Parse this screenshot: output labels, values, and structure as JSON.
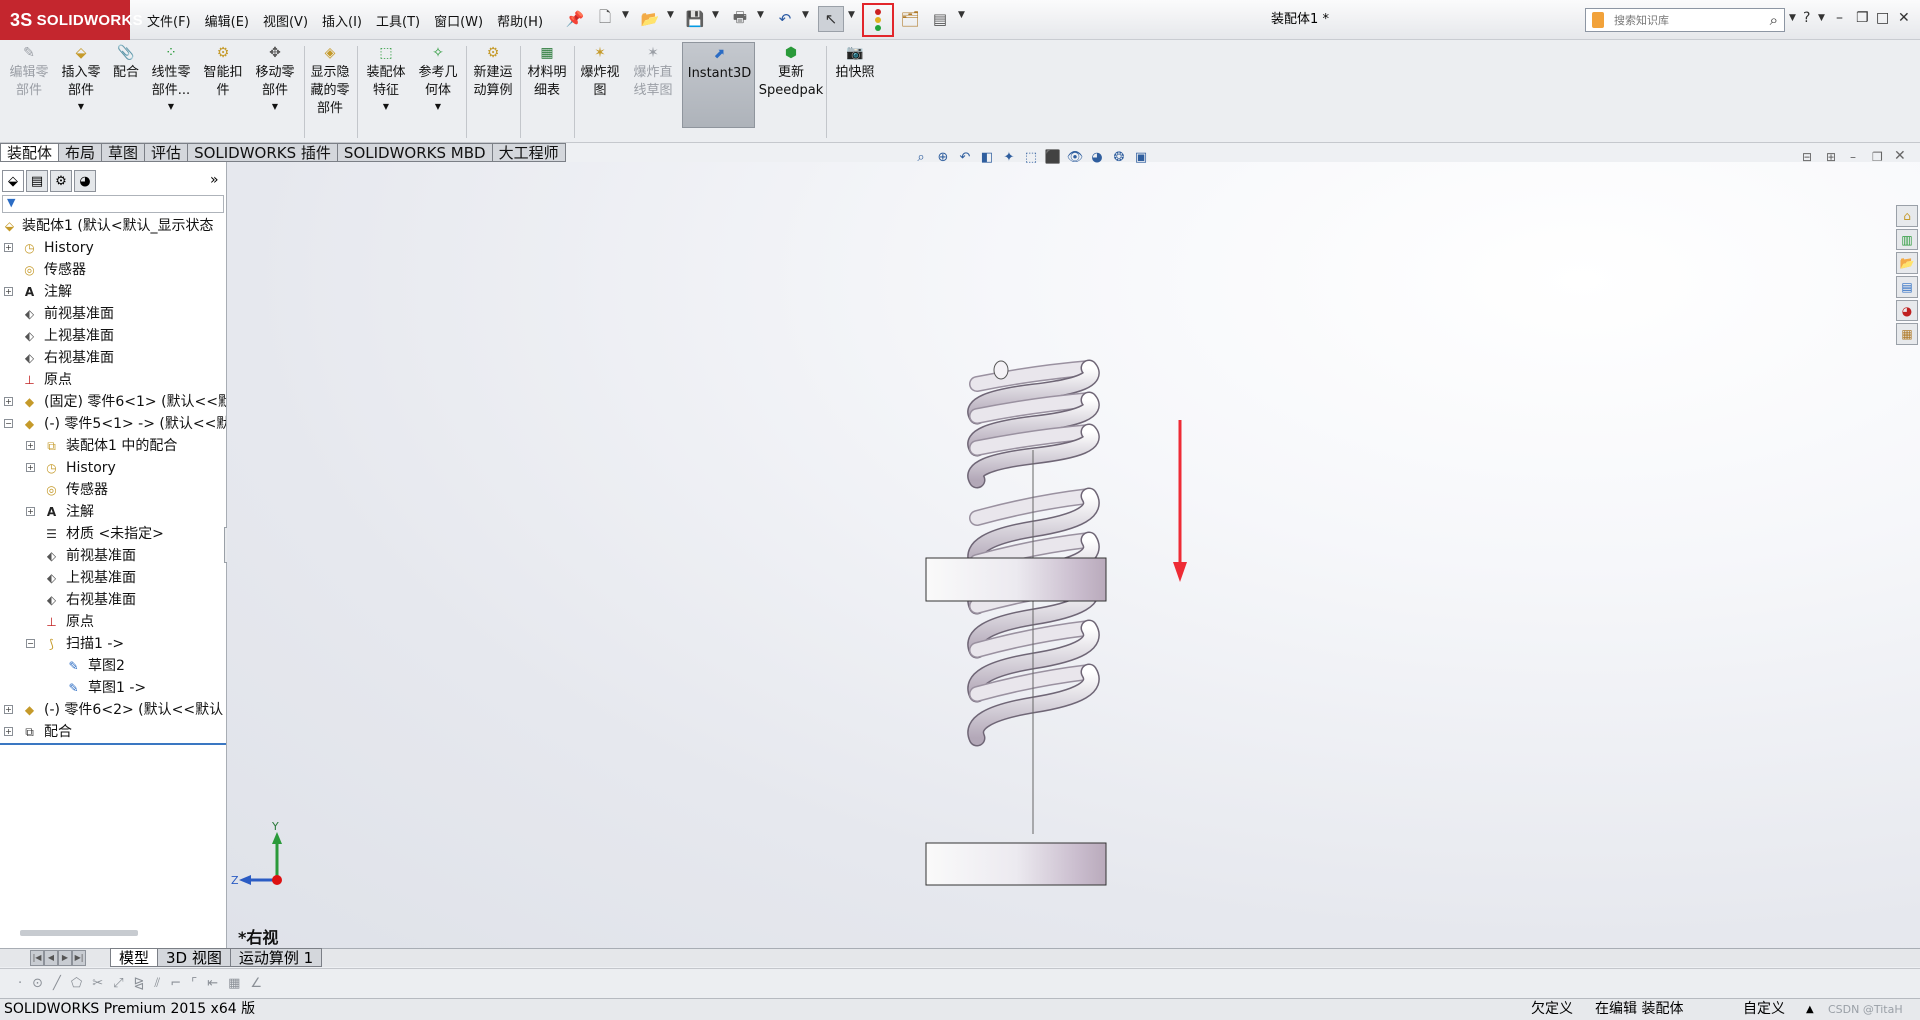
{
  "app": {
    "logo": "SOLIDWORKS",
    "logo_mark": "3S",
    "doc_title": "装配体1 *"
  },
  "menus": [
    "文件(F)",
    "编辑(E)",
    "视图(V)",
    "插入(I)",
    "工具(T)",
    "窗口(W)",
    "帮助(H)"
  ],
  "search": {
    "placeholder": "搜索知识库"
  },
  "command_manager": {
    "edit_part": [
      "编辑零",
      "部件"
    ],
    "insert_part": [
      "插入零",
      "部件"
    ],
    "mate": "配合",
    "linear_pattern": [
      "线性零",
      "部件..."
    ],
    "smart_fastener": [
      "智能扣",
      "件"
    ],
    "move_part": [
      "移动零",
      "部件"
    ],
    "show_hidden": [
      "显示隐",
      "藏的零",
      "部件"
    ],
    "assembly_feature": [
      "装配体",
      "特征"
    ],
    "reference_geometry": [
      "参考几",
      "何体"
    ],
    "new_motion_study": [
      "新建运",
      "动算例"
    ],
    "bom": [
      "材料明",
      "细表"
    ],
    "exploded_view": [
      "爆炸视",
      "图"
    ],
    "explode_line_sketch": [
      "爆炸直",
      "线草图"
    ],
    "instant3d": "Instant3D",
    "speedpak": [
      "更新",
      "Speedpak"
    ],
    "snapshot": "拍快照"
  },
  "cmd_tabs": [
    "装配体",
    "布局",
    "草图",
    "评估",
    "SOLIDWORKS 插件",
    "SOLIDWORKS MBD",
    "大工程师"
  ],
  "tree": [
    {
      "label": "装配体1  (默认<默认_显示状态",
      "icon": "assembly-icon"
    },
    {
      "label": "History",
      "icon": "history-icon"
    },
    {
      "label": "传感器",
      "icon": "sensor-icon"
    },
    {
      "label": "注解",
      "icon": "annotation-icon"
    },
    {
      "label": "前视基准面",
      "icon": "plane-icon"
    },
    {
      "label": "上视基准面",
      "icon": "plane-icon"
    },
    {
      "label": "右视基准面",
      "icon": "plane-icon"
    },
    {
      "label": "原点",
      "icon": "origin-icon"
    },
    {
      "label": "(固定) 零件6<1> (默认<<默",
      "icon": "part-icon"
    },
    {
      "label": "(-) 零件5<1> -> (默认<<默",
      "icon": "part-icon"
    },
    {
      "label": "装配体1 中的配合",
      "icon": "mates-icon"
    },
    {
      "label": "History",
      "icon": "history-icon"
    },
    {
      "label": "传感器",
      "icon": "sensor-icon"
    },
    {
      "label": "注解",
      "icon": "annotation-icon"
    },
    {
      "label": "材质 <未指定>",
      "icon": "material-icon"
    },
    {
      "label": "前视基准面",
      "icon": "plane-icon"
    },
    {
      "label": "上视基准面",
      "icon": "plane-icon"
    },
    {
      "label": "右视基准面",
      "icon": "plane-icon"
    },
    {
      "label": "原点",
      "icon": "origin-icon"
    },
    {
      "label": "扫描1 ->",
      "icon": "sweep-icon"
    },
    {
      "label": "草图2",
      "icon": "sketch-icon"
    },
    {
      "label": "草图1 ->",
      "icon": "sketch-icon"
    },
    {
      "label": "(-) 零件6<2> (默认<<默认",
      "icon": "part-icon"
    },
    {
      "label": "配合",
      "icon": "mates-icon"
    }
  ],
  "viewport": {
    "view_name": "*右视",
    "axis_y": "Y",
    "axis_z": "Z"
  },
  "bottom_tabs": [
    "模型",
    "3D 视图",
    "运动算例 1"
  ],
  "status": {
    "product": "SOLIDWORKS Premium 2015 x64 版",
    "underdefined": "欠定义",
    "editing": "在编辑 装配体",
    "custom": "自定义",
    "watermark": "CSDN @TitaH"
  },
  "colors": {
    "brand": "#c4262e",
    "highlight_box": "#e2262b",
    "arrow": "#ee2b35",
    "tree_accent": "#3a77c2"
  }
}
